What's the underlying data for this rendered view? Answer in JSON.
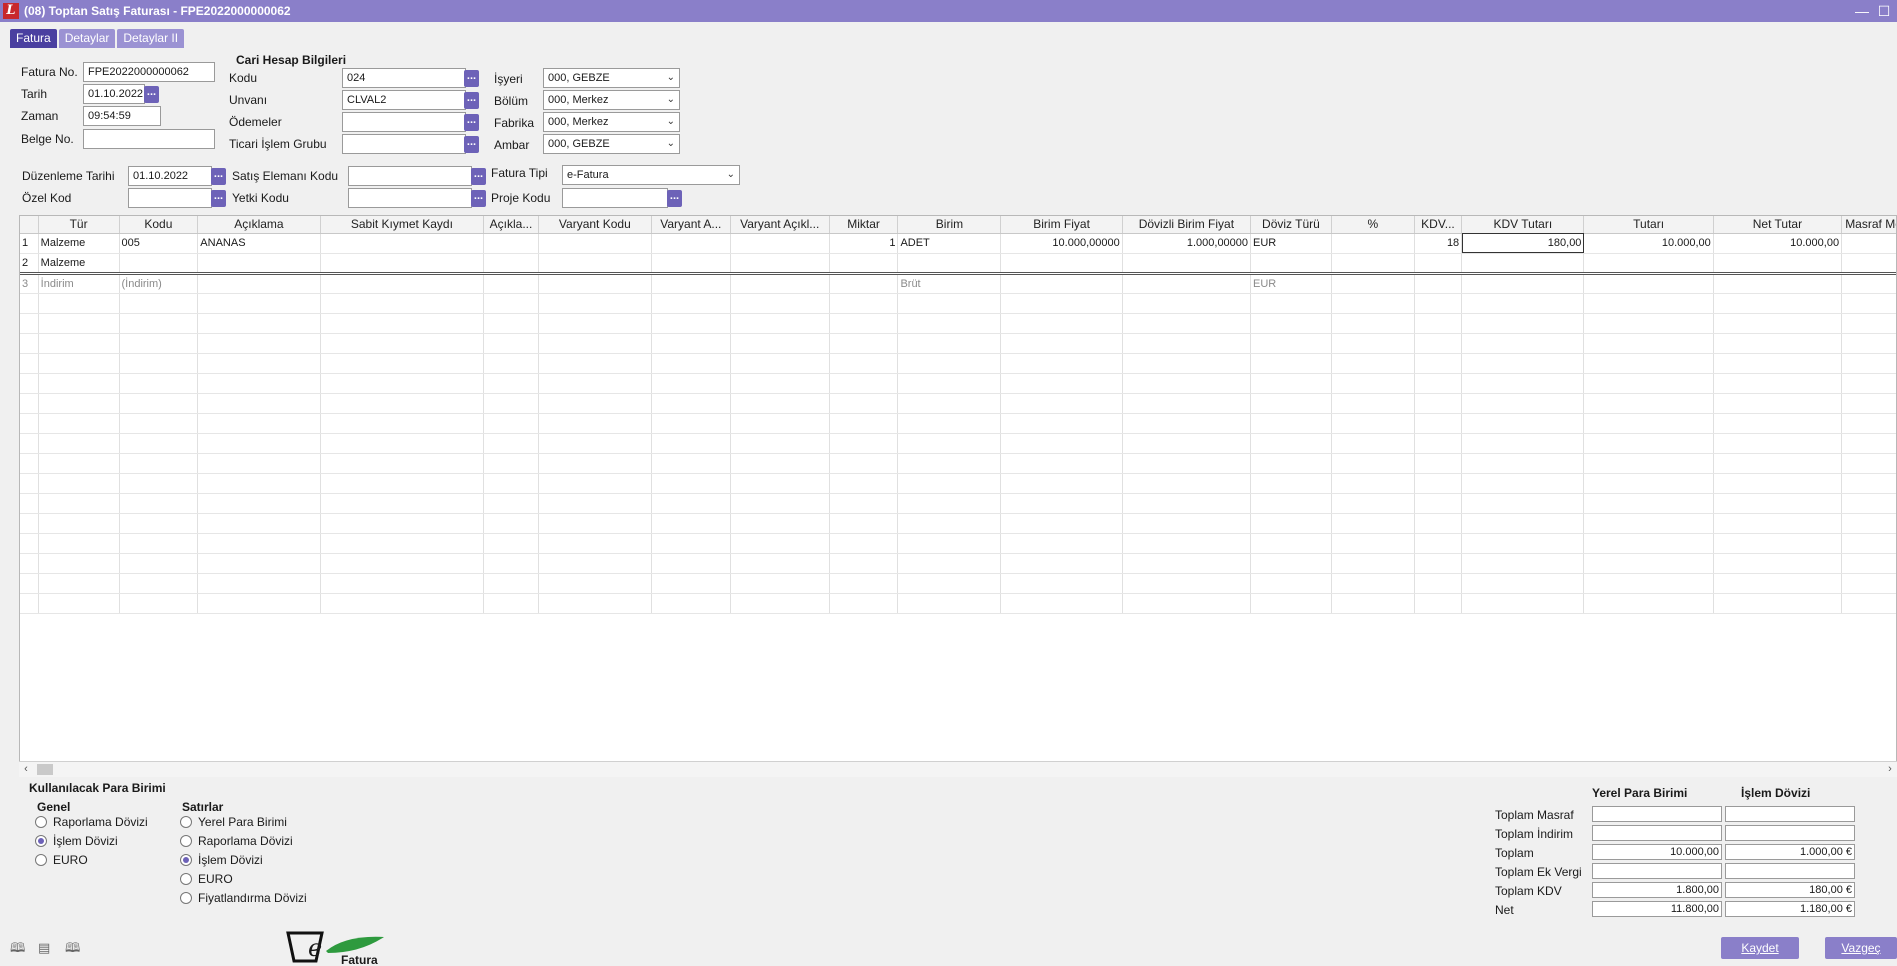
{
  "window": {
    "title": "(08) Toptan Satış Faturası - FPE2022000000062",
    "logo": "L"
  },
  "tabs": [
    "Fatura",
    "Detaylar",
    "Detaylar II"
  ],
  "header": {
    "fatura_no_label": "Fatura No.",
    "fatura_no": "FPE2022000000062",
    "tarih_label": "Tarih",
    "tarih": "01.10.2022",
    "zaman_label": "Zaman",
    "zaman": "09:54:59",
    "belge_no_label": "Belge No.",
    "belge_no": ""
  },
  "cari": {
    "title": "Cari Hesap Bilgileri",
    "kodu_label": "Kodu",
    "kodu": "024",
    "unvani_label": "Unvanı",
    "unvani": "CLVAL2",
    "odemeler_label": "Ödemeler",
    "odemeler": "",
    "ticari_label": "Ticari İşlem Grubu",
    "ticari": ""
  },
  "org": {
    "isyeri_label": "İşyeri",
    "isyeri": "000, GEBZE",
    "bolum_label": "Bölüm",
    "bolum": "000, Merkez",
    "fabrika_label": "Fabrika",
    "fabrika": "000, Merkez",
    "ambar_label": "Ambar",
    "ambar": "000, GEBZE"
  },
  "extra": {
    "duzenleme_label": "Düzenleme Tarihi",
    "duzenleme": "01.10.2022",
    "ozel_kod_label": "Özel Kod",
    "ozel_kod": "",
    "satis_label": "Satış Elemanı Kodu",
    "satis": "",
    "yetki_label": "Yetki Kodu",
    "yetki": "",
    "fatura_tipi_label": "Fatura Tipi",
    "fatura_tipi": "e-Fatura",
    "proje_label": "Proje Kodu",
    "proje": ""
  },
  "grid": {
    "columns": [
      "",
      "Tür",
      "Kodu",
      "Açıklama",
      "Sabit Kıymet Kaydı",
      "Açıkla...",
      "Varyant Kodu",
      "Varyant A...",
      "Varyant Açıkl...",
      "Miktar",
      "Birim",
      "Birim Fiyat",
      "Dövizli Birim Fiyat",
      "Döviz Türü",
      "%",
      "KDV...",
      "KDV Tutarı",
      "Tutarı",
      "Net Tutar",
      "Masraf Merk"
    ],
    "rows": [
      [
        "1",
        "Malzeme",
        "005",
        "ANANAS",
        "",
        "",
        "",
        "",
        "",
        "1",
        "ADET",
        "10.000,00000",
        "1.000,00000",
        "EUR",
        "",
        "18",
        "180,00",
        "10.000,00",
        "10.000,00",
        ""
      ],
      [
        "2",
        "Malzeme",
        "",
        "",
        "",
        "",
        "",
        "",
        "",
        "",
        "",
        "",
        "",
        "",
        "",
        "",
        "",
        "",
        "",
        ""
      ],
      [
        "3",
        "İndirim",
        "(İndirim)",
        "",
        "",
        "",
        "",
        "",
        "",
        "",
        "Brüt",
        "",
        "",
        "EUR",
        "",
        "",
        "",
        "",
        "",
        ""
      ]
    ]
  },
  "currency": {
    "title": "Kullanılacak Para Birimi",
    "genel_title": "Genel",
    "genel": [
      "Raporlama Dövizi",
      "İşlem Dövizi",
      "EURO"
    ],
    "genel_selected": 1,
    "satirlar_title": "Satırlar",
    "satirlar": [
      "Yerel Para Birimi",
      "Raporlama Dövizi",
      "İşlem Dövizi",
      "EURO",
      "Fiyatlandırma Dövizi"
    ],
    "satirlar_selected": 2
  },
  "totals": {
    "col_local": "Yerel Para Birimi",
    "col_tx": "İşlem Dövizi",
    "rows": [
      {
        "label": "Toplam Masraf",
        "local": "",
        "tx": ""
      },
      {
        "label": "Toplam İndirim",
        "local": "",
        "tx": ""
      },
      {
        "label": "Toplam",
        "local": "10.000,00",
        "tx": "1.000,00 €"
      },
      {
        "label": "Toplam Ek Vergi",
        "local": "",
        "tx": ""
      },
      {
        "label": "Toplam KDV",
        "local": "1.800,00",
        "tx": "180,00 €"
      },
      {
        "label": "Net",
        "local": "11.800,00",
        "tx": "1.180,00 €"
      }
    ]
  },
  "buttons": {
    "save": "Kaydet",
    "cancel": "Vazgeç"
  },
  "efatura_logo": {
    "letter": "e",
    "text": "Fatura"
  },
  "colors": {
    "accent": "#8a7fc9",
    "tab_active": "#4a3fa0",
    "button_dots": "#6d62b8"
  }
}
